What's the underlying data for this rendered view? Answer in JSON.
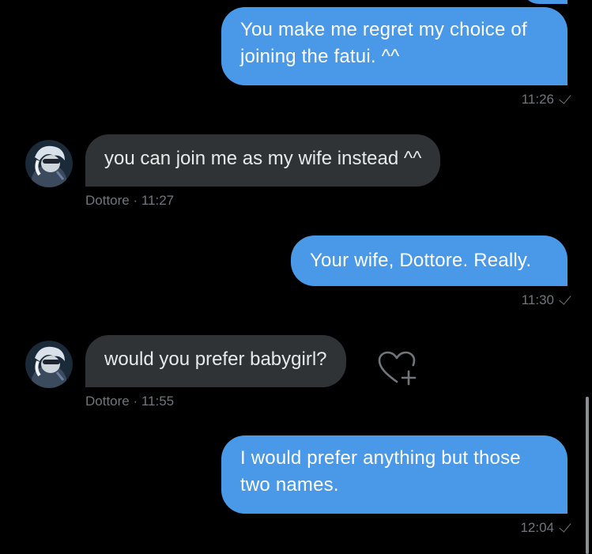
{
  "messages": [
    {
      "text": "You make me regret my choice of joining the fatui. ^^",
      "time": "11:26"
    },
    {
      "text": "you can join me as my wife instead ^^",
      "sender": "Dottore",
      "time": "11:27"
    },
    {
      "text": "Your wife, Dottore. Really.",
      "time": "11:30"
    },
    {
      "text": "would you prefer babygirl?",
      "sender": "Dottore",
      "time": "11:55"
    },
    {
      "text": "I would prefer anything but those two names.",
      "time": "12:04"
    }
  ],
  "separator": " · ",
  "colors": {
    "background": "#000000",
    "outgoing_bubble": "#4a99e9",
    "incoming_bubble": "#2f3336",
    "meta_text": "#71767b"
  },
  "icons": {
    "read_receipt": "check-icon",
    "react": "heart-plus-icon"
  }
}
